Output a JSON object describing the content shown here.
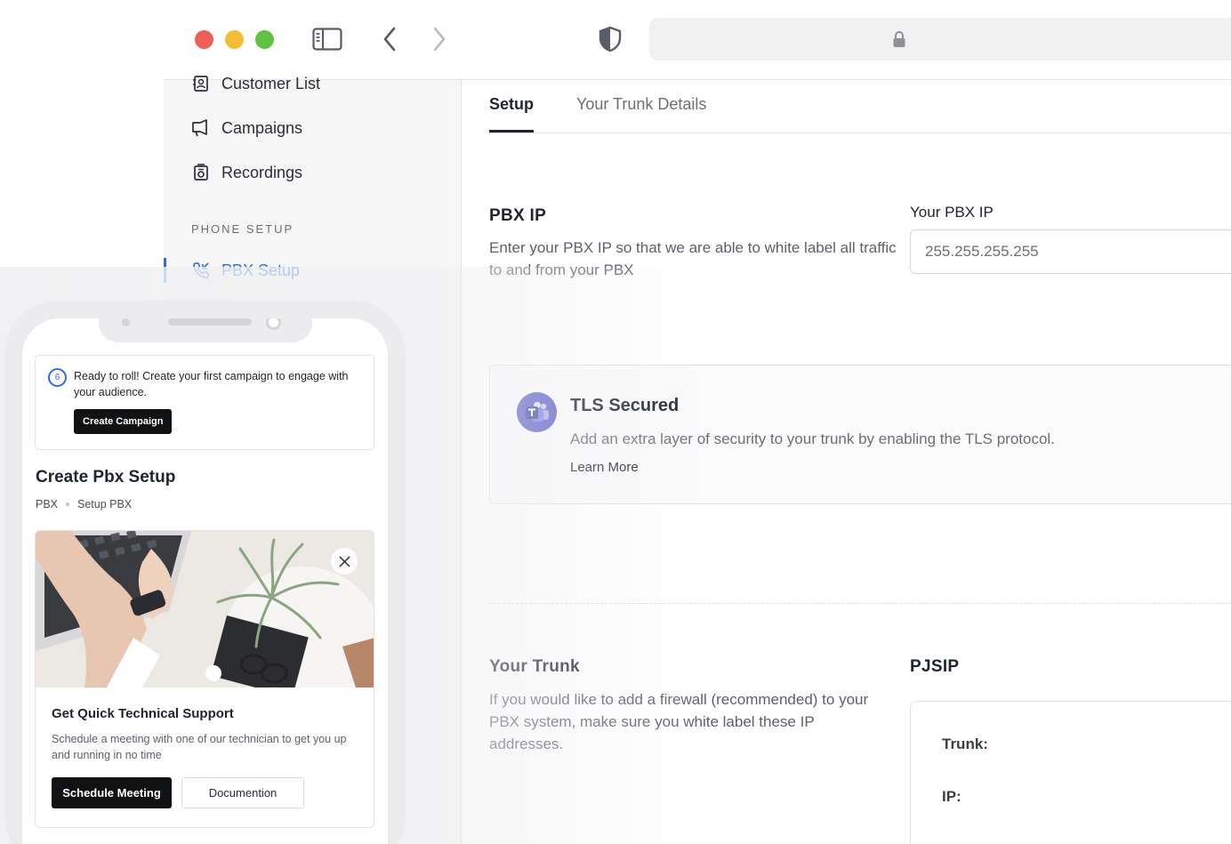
{
  "sidebar": {
    "items": [
      {
        "label": "Customer List",
        "icon": "contact-book-icon"
      },
      {
        "label": "Campaigns",
        "icon": "megaphone-icon"
      },
      {
        "label": "Recordings",
        "icon": "recording-icon"
      }
    ],
    "section_title": "PHONE SETUP",
    "active_item": {
      "label": "PBX Setup",
      "icon": "phone-call-icon"
    }
  },
  "tabs": [
    {
      "label": "Setup",
      "active": true
    },
    {
      "label": "Your Trunk Details",
      "active": false
    }
  ],
  "pbx_ip": {
    "title": "PBX IP",
    "description": "Enter your PBX IP so that we are able to white label all traffic to and from your PBX",
    "field_label": "Your PBX IP",
    "placeholder": "255.255.255.255"
  },
  "tls": {
    "title": "TLS Secured",
    "description": "Add an extra layer of security to your trunk by enabling the TLS protocol.",
    "link": "Learn More"
  },
  "trunk": {
    "title": "Your Trunk",
    "description": "If you would like to add a firewall (recommended) to your PBX system, make sure you white label these IP addresses.",
    "protocol_label": "PJSIP",
    "trunk_label": "Trunk:",
    "ip_label": "IP:"
  },
  "phone": {
    "notice": {
      "step": "6",
      "text": "Ready to roll! Create your first campaign to engage with your audience.",
      "button": "Create Campaign"
    },
    "title": "Create Pbx Setup",
    "breadcrumb": [
      "PBX",
      "Setup PBX"
    ],
    "support": {
      "title": "Get Quick Technical Support",
      "description": "Schedule a meeting with one of our technician to get you up and running in no time",
      "primary_button": "Schedule Meeting",
      "secondary_button": "Documention"
    }
  },
  "colors": {
    "accent": "#2f6ae6",
    "dark_button": "#111214",
    "teams_purple": "#5b5fc7"
  }
}
